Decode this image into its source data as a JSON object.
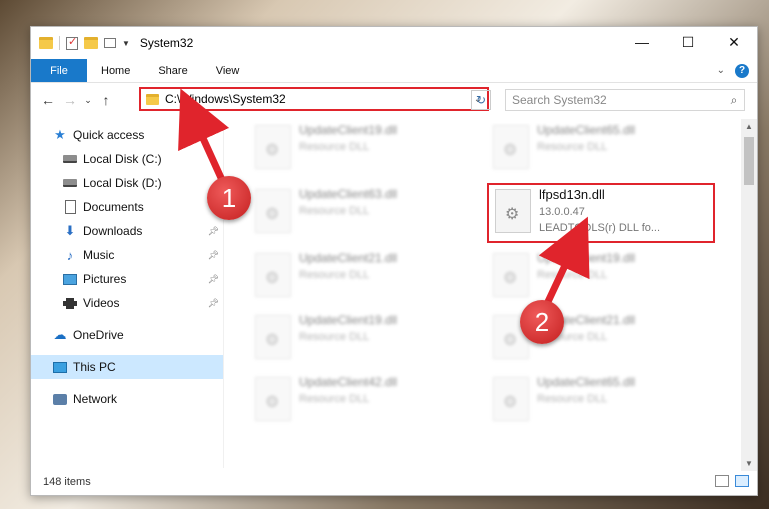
{
  "window": {
    "title": "System32",
    "controls": {
      "minimize": "—",
      "maximize": "☐",
      "close": "✕"
    }
  },
  "ribbon": {
    "tabs": [
      "File",
      "Home",
      "Share",
      "View"
    ],
    "help": "?"
  },
  "nav": {
    "address_path": "C:\\Windows\\System32",
    "search_placeholder": "Search System32"
  },
  "sidebar": {
    "items": [
      {
        "label": "Quick access",
        "icon": "star-icon"
      },
      {
        "label": "Local Disk (C:)",
        "icon": "disk-icon"
      },
      {
        "label": "Local Disk (D:)",
        "icon": "disk-icon"
      },
      {
        "label": "Documents",
        "icon": "documents-icon"
      },
      {
        "label": "Downloads",
        "icon": "downloads-icon"
      },
      {
        "label": "Music",
        "icon": "music-icon"
      },
      {
        "label": "Pictures",
        "icon": "pictures-icon"
      },
      {
        "label": "Videos",
        "icon": "videos-icon"
      },
      {
        "label": "OneDrive",
        "icon": "onedrive-icon"
      },
      {
        "label": "This PC",
        "icon": "this-pc-icon"
      },
      {
        "label": "Network",
        "icon": "network-icon"
      }
    ]
  },
  "files": [
    {
      "name": "UpdateClient19.dll",
      "type": "Resource DLL"
    },
    {
      "name": "UpdateClient65.dll",
      "type": "Resource DLL"
    },
    {
      "name": "UpdateClient63.dll",
      "type": "Resource DLL"
    },
    {
      "name": "lfpsd13n.dll",
      "version": "13.0.0.47",
      "description": "LEADTOOLS(r) DLL fo..."
    },
    {
      "name": "UpdateClient21.dll",
      "type": "Resource DLL"
    },
    {
      "name": "UpdateClient19.dll",
      "type": "Resource DLL"
    },
    {
      "name": "UpdateClient19.dll",
      "type": "Resource DLL"
    },
    {
      "name": "UpdateClient21.dll",
      "type": "Resource DLL"
    },
    {
      "name": "UpdateClient42.dll",
      "type": "Resource DLL"
    },
    {
      "name": "UpdateClient65.dll",
      "type": "Resource DLL"
    }
  ],
  "status": {
    "item_count": "148 items"
  },
  "callouts": {
    "step1": "1",
    "step2": "2"
  },
  "colors": {
    "accent": "#1979ca",
    "highlight": "#e0242c",
    "selected": "#cce8ff"
  }
}
